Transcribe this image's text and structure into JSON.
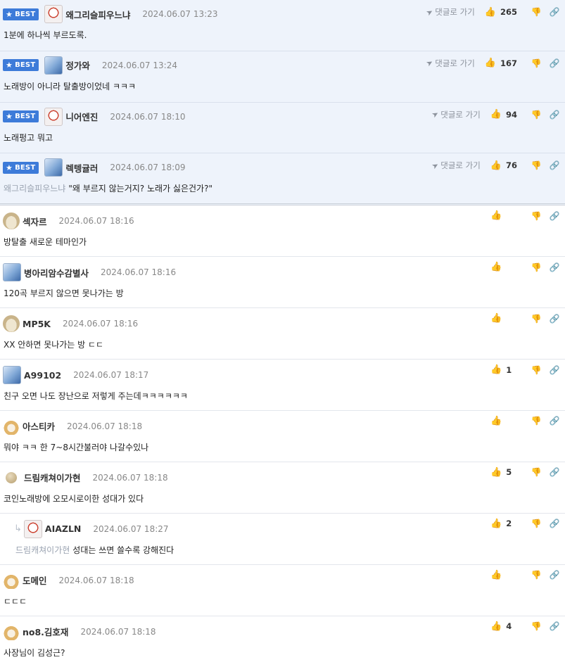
{
  "icons": {
    "best_star": "★",
    "goto": "➤",
    "like": "👍",
    "dislike": "👎",
    "link": "🔗",
    "reply": "↳"
  },
  "best_label": "BEST",
  "goto_label": "댓글로 가기",
  "best_comments": [
    {
      "nick": "왜그리슬피우느냐",
      "date": "2024.06.07 13:23",
      "text": "1분에 하나씩 부르도록.",
      "likes": "265",
      "avatar": "dog"
    },
    {
      "nick": "정가와",
      "date": "2024.06.07 13:24",
      "text": "노래방이 아니라 탈출방이었네 ㅋㅋㅋ",
      "likes": "167",
      "avatar": "ice"
    },
    {
      "nick": "니어엔진",
      "date": "2024.06.07 18:10",
      "text": "노래펑고 뭐고",
      "likes": "94",
      "avatar": "dog"
    },
    {
      "nick": "렉텡귤러",
      "date": "2024.06.07 18:09",
      "mention": "왜그리슬피우느냐",
      "text": "\"왜 부르지 않는거지? 노래가 싫은건가?\"",
      "likes": "76",
      "avatar": "ice"
    }
  ],
  "comments": [
    {
      "nick": "섹자르",
      "date": "2024.06.07 18:16",
      "text": "방탈출 새로운 테마인가",
      "likes": "",
      "avatar": "pup"
    },
    {
      "nick": "병아리암수감별사",
      "date": "2024.06.07 18:16",
      "text": "120곡 부르지 않으면 못나가는 방",
      "likes": "",
      "avatar": "ice"
    },
    {
      "nick": "MP5K",
      "date": "2024.06.07 18:16",
      "text": "XX 안하면 못나가는 방 ㄷㄷ",
      "likes": "",
      "avatar": "pup"
    },
    {
      "nick": "A99102",
      "date": "2024.06.07 18:17",
      "text": "친구 오면 나도 장난으로 저렇게 주는데ㅋㅋㅋㅋㅋㅋ",
      "likes": "1",
      "avatar": "ice"
    },
    {
      "nick": "아스티카",
      "date": "2024.06.07 18:18",
      "text": "뭐야 ㅋㅋ 한 7~8시간불러야 나갈수있나",
      "likes": "",
      "avatar": "fox"
    },
    {
      "nick": "드림캐쳐이가현",
      "date": "2024.06.07 18:18",
      "text": "코인노래방에 오모시로이한 성대가 있다",
      "likes": "5",
      "avatar": "ball"
    },
    {
      "nick": "AIAZLN",
      "date": "2024.06.07 18:27",
      "mention": "드림캐쳐이가현",
      "text": "성대는 쓰면 쓸수록 강해진다",
      "likes": "2",
      "avatar": "dog",
      "reply": true
    },
    {
      "nick": "도메인",
      "date": "2024.06.07 18:18",
      "text": "ㄷㄷㄷ",
      "likes": "",
      "avatar": "fox"
    },
    {
      "nick": "no8.김호재",
      "date": "2024.06.07 18:18",
      "text": "사장님이 김성근?",
      "likes": "4",
      "avatar": "fox"
    }
  ]
}
